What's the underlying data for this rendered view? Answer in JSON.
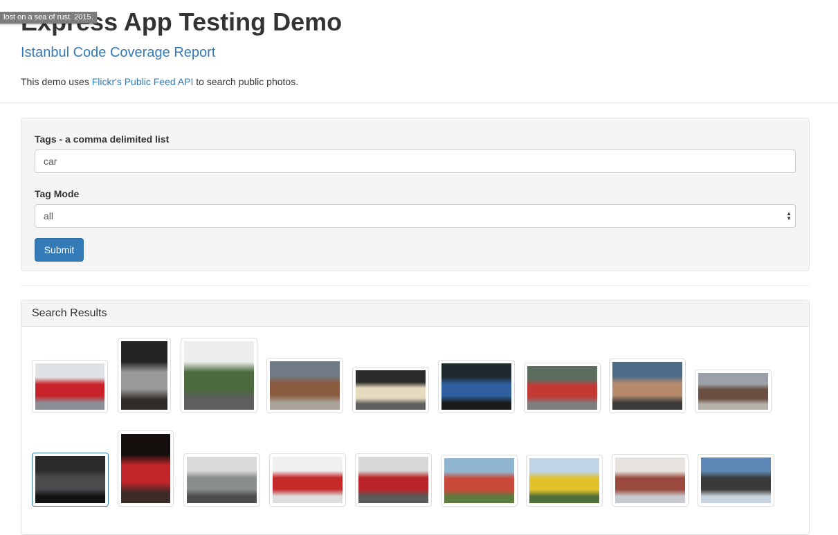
{
  "tooltip": "lost on a sea of rust. 2015.",
  "header": {
    "title": "Express App Testing Demo",
    "subtitle_link": "Istanbul Code Coverage Report",
    "intro_prefix": "This demo uses ",
    "intro_link": "Flickr's Public Feed API",
    "intro_suffix": " to search public photos."
  },
  "form": {
    "tags_label": "Tags - a comma delimited list",
    "tags_value": "car",
    "tag_mode_label": "Tag Mode",
    "tag_mode_value": "all",
    "submit_label": "Submit"
  },
  "results": {
    "heading": "Search Results",
    "photos": [
      {
        "colors": [
          "#dfe3e6",
          "#c8232a",
          "#8a8f95"
        ]
      },
      {
        "colors": [
          "#262422",
          "#9a9a9a",
          "#2f2b28"
        ]
      },
      {
        "colors": [
          "#ededed",
          "#4b6b3f",
          "#5e5e5e"
        ]
      },
      {
        "colors": [
          "#6f7a86",
          "#8a5a3e",
          "#aaa39b"
        ]
      },
      {
        "colors": [
          "#2b2b2b",
          "#e8dcc0",
          "#606060"
        ]
      },
      {
        "colors": [
          "#1f2a2e",
          "#2f5f9e",
          "#1a1c1c"
        ]
      },
      {
        "colors": [
          "#5b6e60",
          "#c33a35",
          "#7e7e7e"
        ]
      },
      {
        "colors": [
          "#4b6b89",
          "#b58b6c",
          "#3c3c3c"
        ]
      },
      {
        "colors": [
          "#9aa1a8",
          "#6b4f42",
          "#b5b0a8"
        ]
      },
      {
        "colors": [
          "#2a2a2a",
          "#4b4b4e",
          "#121212"
        ]
      },
      {
        "colors": [
          "#150f0e",
          "#c0262a",
          "#3b2a26"
        ]
      },
      {
        "colors": [
          "#dadada",
          "#8a8f8b",
          "#4c4c4c"
        ]
      },
      {
        "colors": [
          "#f0f0f0",
          "#c42a2a",
          "#dddddd"
        ]
      },
      {
        "colors": [
          "#d8d8d8",
          "#b82428",
          "#5a5a5a"
        ]
      },
      {
        "colors": [
          "#8fb5d0",
          "#c94a3a",
          "#5d7a3f"
        ]
      },
      {
        "colors": [
          "#bfd4e4",
          "#e2c22a",
          "#4f6e3a"
        ]
      },
      {
        "colors": [
          "#e7e3df",
          "#9a4b3e",
          "#c8ccd0"
        ]
      },
      {
        "colors": [
          "#5e88b5",
          "#3a3a3a",
          "#c9d6df"
        ]
      }
    ]
  }
}
